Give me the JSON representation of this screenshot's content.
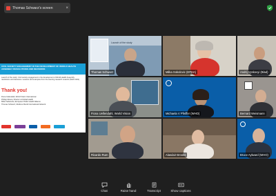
{
  "share_bar": {
    "text": "Thomas Schwarz's screen",
    "close_glyph": "×"
  },
  "slide": {
    "header_title": "CIVIL SOCIETY ENGAGEMENT IN THE DEVELOPMENT OF WORLD HEALTH ASSEMBLY RESOLUTIONS AND DECISIONS",
    "body_text": "Launch of the study: Civil society engagement in the development of World Health Assembly resolutions and decisions. Lessons and examples from the steering research network (WHO 2021)",
    "thanks": "Thank you!",
    "names": [
      "Fiona Uellendahl, World Vision International",
      "Philipp Mosca, Director at Global Health",
      "Mitko Salsiovski, European Public Health Alliance",
      "Thomas Schwarz, Medicus Mundi International Network"
    ],
    "footer_logos": [
      "ecp",
      "partner",
      "who",
      "wvi",
      "mmi"
    ]
  },
  "participants": [
    {
      "name": "Thomas Schwarz"
    },
    {
      "name": "Milka Sokolovic (EPHA)"
    },
    {
      "name": "Andrij Vyskovyi (Blad)"
    },
    {
      "name": "Fiona Uellendahl, World Vision"
    },
    {
      "name": "Michaela V Pfeiffer (WHO)"
    },
    {
      "name": "Bernard Weismann"
    },
    {
      "name": "Ricardo Rum"
    },
    {
      "name": "Alasdair Brooks"
    },
    {
      "name": "Bruce Aylward (WHO)"
    }
  ],
  "tile_tags": {
    "launch_label": "Launch of the study"
  },
  "controls": [
    {
      "label": "Chat",
      "icon": "chat-icon"
    },
    {
      "label": "Raise hand",
      "icon": "raise-hand-icon"
    },
    {
      "label": "Transcript",
      "icon": "transcript-icon"
    },
    {
      "label": "Show captions",
      "icon": "captions-icon"
    }
  ],
  "colors": {
    "background": "#1f1f1f",
    "who_blue": "#0a5ea8",
    "slide_header": "#1a9fd6",
    "accent_red": "#e2342c",
    "shield_green": "#2ea043"
  }
}
